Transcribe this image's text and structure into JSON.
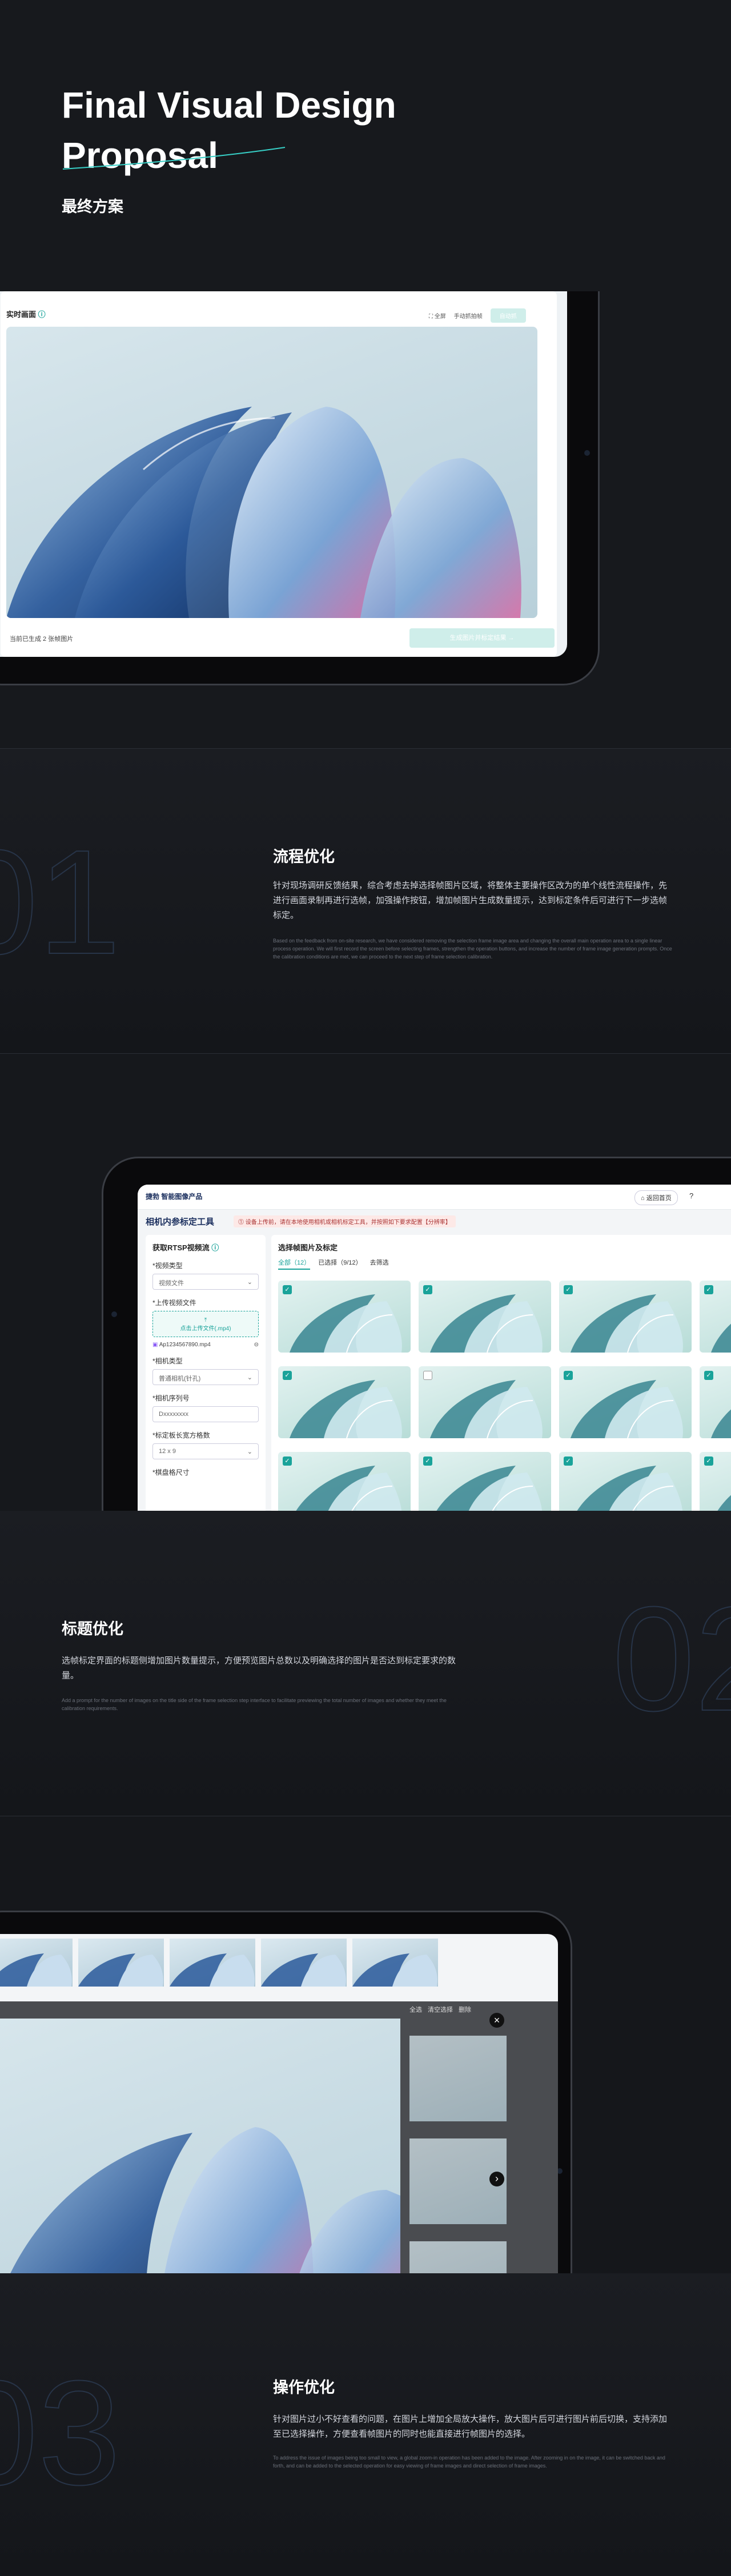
{
  "header": {
    "title_line1": "Final Visual Design",
    "title_line2": "Proposal",
    "subtitle": "最终方案"
  },
  "mock1": {
    "panel_title": "实时画面",
    "toolbar_fullscreen": "全屏",
    "toolbar_capture": "手动抓拍帧",
    "toolbar_btn": "自动抓",
    "status_text": "当前已生成 2 张帧图片",
    "primary_btn": "生成图片并标定结果 →"
  },
  "section1": {
    "number": "01",
    "title": "流程优化",
    "desc": "针对现场调研反馈结果，综合考虑去掉选择帧图片区域，将整体主要操作区改为的单个线性流程操作，先进行画面录制再进行选帧，加强操作按钮，增加帧图片生成数量提示，达到标定条件后可进行下一步选帧标定。",
    "desc_en": "Based on the feedback from on-site research, we have considered removing the selection frame image area and changing the overall main operation area to a single linear process operation. We will first record the screen before selecting frames, strengthen the operation buttons, and increase the number of frame image generation prompts. Once the calibration conditions are met, we can proceed to the next step of frame selection calibration."
  },
  "mock2": {
    "brand": "捷勃 智能图像产品",
    "back_btn": "返回首页",
    "help": "?",
    "page_title": "相机内参标定工具",
    "alert": "设备上传前，请在本地使用相机或相机标定工具，并按照如下要求配置【分辨率】",
    "left_title": "获取RTSP视频流",
    "fields": [
      {
        "label": "*视频类型",
        "value": "视频文件"
      },
      {
        "label": "*上传视频文件",
        "value": "点击上传文件(.mp4)"
      },
      {
        "label": "file",
        "value": "Ap1234567890.mp4"
      },
      {
        "label": "*相机类型",
        "value": "普通相机(针孔)"
      },
      {
        "label": "*相机序列号",
        "value": "Dxxxxxxxx"
      },
      {
        "label": "*标定板长宽方格数",
        "value": "12 x 9"
      },
      {
        "label": "*棋盘格尺寸",
        "value": ""
      }
    ],
    "right_title": "选择帧图片及标定",
    "tabs": [
      "全部（12）",
      "已选择（9/12）",
      "去筛选"
    ]
  },
  "section2": {
    "number": "02",
    "title": "标题优化",
    "desc": "选帧标定界面的标题侧增加图片数量提示，方便预览图片总数以及明确选择的图片是否达到标定要求的数量。",
    "desc_en": "Add a prompt for the number of images on the title side of the frame selection step interface to facilitate previewing the total number of images and whether they meet the calibration requirements."
  },
  "mock3": {
    "top_right": [
      "全选",
      "清空选择",
      "删除"
    ],
    "close": "×",
    "next": "›"
  },
  "section3": {
    "number": "03",
    "title": "操作优化",
    "desc": "针对图片过小不好查看的问题，在图片上增加全局放大操作，放大图片后可进行图片前后切换，支持添加至已选择操作，方便查看帧图片的同时也能直接进行帧图片的选择。",
    "desc_en": "To address the issue of images being too small to view, a global zoom-in operation has been added to the image. After zooming in on the image, it can be switched back and forth, and can be added to the selected operation for easy viewing of frame images and direct selection of frame images."
  }
}
